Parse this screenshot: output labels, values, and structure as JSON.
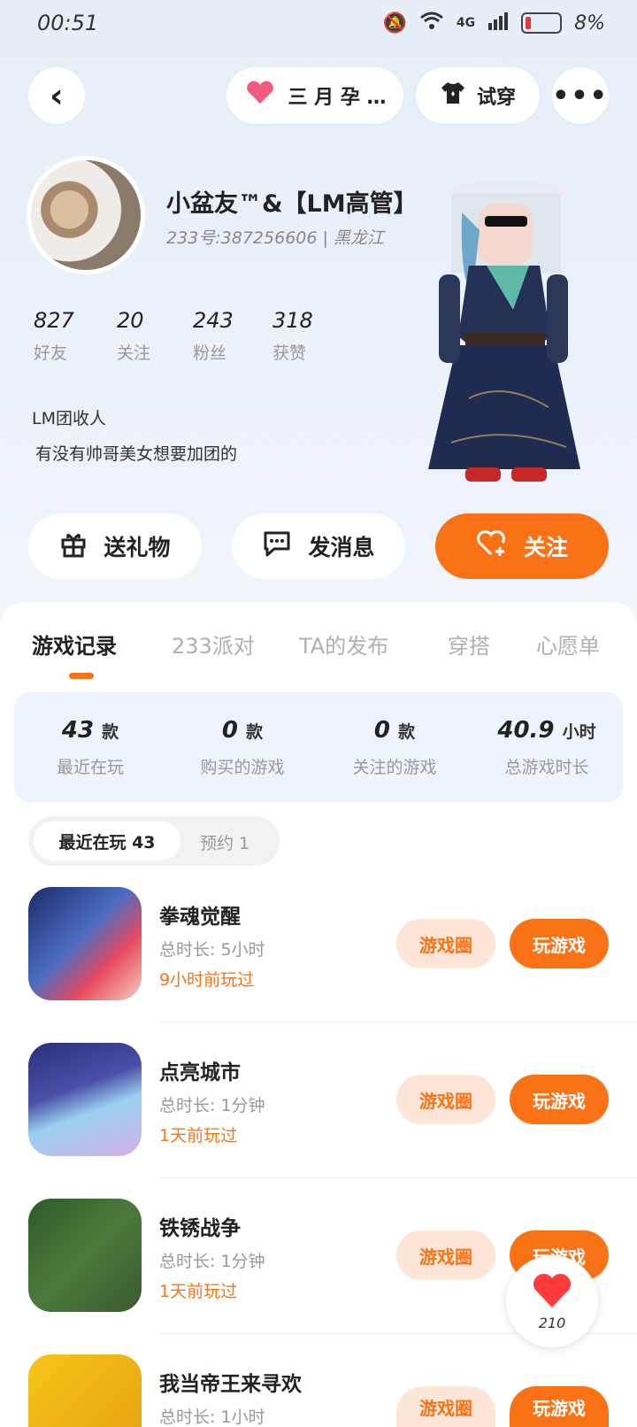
{
  "status_bar": {
    "time": "00:51",
    "network": "4G",
    "battery": "8%"
  },
  "top_bar": {
    "back_icon": "back-arrow-icon",
    "tag_label": "三 月 孕 …",
    "try_on_label": "试穿",
    "more_icon": "more-dots-icon"
  },
  "profile": {
    "nickname": "小盆友™&【LM高管】",
    "uid_line": "233号:387256606 | 黑龙江",
    "stats": [
      {
        "num": "827",
        "label": "好友"
      },
      {
        "num": "20",
        "label": "关注"
      },
      {
        "num": "243",
        "label": "粉丝"
      },
      {
        "num": "318",
        "label": "获赞"
      }
    ],
    "bio_line1": "LM团收人",
    "bio_line2": "有没有帅哥美女想要加团的"
  },
  "actions": {
    "gift": "送礼物",
    "message": "发消息",
    "follow": "关注"
  },
  "tabs": [
    {
      "label": "游戏记录",
      "active": true
    },
    {
      "label": "233派对",
      "active": false
    },
    {
      "label": "TA的发布",
      "active": false
    },
    {
      "label": "穿搭",
      "active": false
    },
    {
      "label": "心愿单",
      "active": false
    }
  ],
  "summary": [
    {
      "value": "43",
      "unit": "款",
      "label": "最近在玩"
    },
    {
      "value": "0",
      "unit": "款",
      "label": "购买的游戏"
    },
    {
      "value": "0",
      "unit": "款",
      "label": "关注的游戏"
    },
    {
      "value": "40.9",
      "unit": "小时",
      "label": "总游戏时长"
    }
  ],
  "segment": {
    "active": "最近在玩 43",
    "inactive": "预约 1"
  },
  "games": [
    {
      "name": "拳魂觉醒",
      "total_time": "总时长:  5小时",
      "last_played": "9小时前玩过"
    },
    {
      "name": "点亮城市",
      "total_time": "总时长:  1分钟",
      "last_played": "1天前玩过"
    },
    {
      "name": "铁锈战争",
      "total_time": "总时长:  1分钟",
      "last_played": "1天前玩过"
    },
    {
      "name": "我当帝王来寻欢",
      "total_time": "总时长:  1小时",
      "last_played": ""
    }
  ],
  "game_buttons": {
    "circle": "游戏圈",
    "play": "玩游戏"
  },
  "like_float": {
    "count": "210"
  },
  "colors": {
    "accent": "#f97316",
    "accent_light": "#fde5d7",
    "summary_bg": "#eef4fd"
  }
}
